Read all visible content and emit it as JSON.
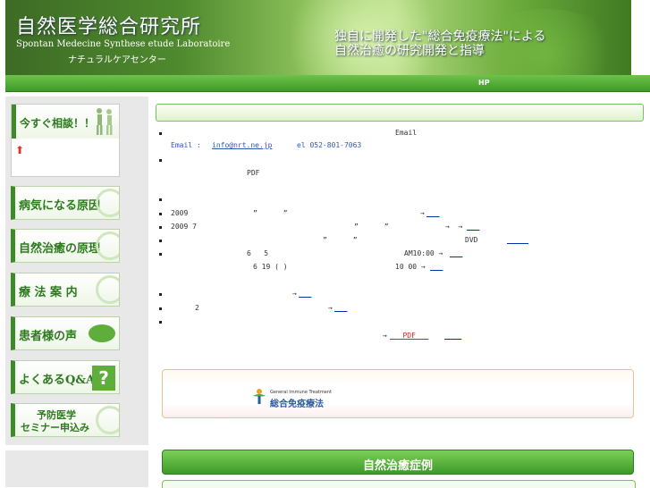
{
  "header": {
    "title": "自然医学総合研究所",
    "subtitle": "Spontan Medecine Synthese etude Laboratoire",
    "center_name": "ナチュラルケアセンター",
    "tagline_line1": "独自に開発した\"総合免疫療法\"による",
    "tagline_line2": "自然治癒の研究開発と指導"
  },
  "nav": {
    "hp_label": "HP"
  },
  "sidebar": {
    "consult_label": "今すぐ相談！！",
    "items": [
      {
        "label": "病気になる原因"
      },
      {
        "label": "自然治癒の原理"
      },
      {
        "label": "療 法 案 内"
      },
      {
        "label": "患者様の声"
      },
      {
        "label": "よくあるQ&A"
      },
      {
        "label_line1": "予防医学",
        "label_line2": "セミナー申込み"
      }
    ]
  },
  "news": {
    "email_word": "Email",
    "email_prefix": "Email : ",
    "email_address": "info@nrt.ne.jp",
    "tel": "el 052-801-7063",
    "pdf_word": "PDF",
    "items": [
      {
        "pre": "2009",
        "mid": "”      ”",
        "arrow": "→",
        "link": "___"
      },
      {
        "pre": "2009 7",
        "mid": "”      ”",
        "arrow": "→  →",
        "link": "___"
      },
      {
        "mid": "”      ”",
        "extra": "DVD",
        "link": "_____"
      },
      {
        "pre": "6   5",
        "extra": "AM10:00 →",
        "link": "___"
      },
      {
        "pre": "6 19 ( )",
        "extra": "10 00 →",
        "link": "___"
      },
      {
        "arrow": "→",
        "link": "___"
      },
      {
        "pre": "2",
        "arrow": "→",
        "link": "___"
      },
      {
        "arrow": "→",
        "pdf_link": "___PDF___",
        "link": "____"
      }
    ]
  },
  "banner": {
    "logo_en": "General Immune Treatment",
    "logo_ja": "総合免疫療法"
  },
  "cases": {
    "title": "自然治癒症例"
  }
}
